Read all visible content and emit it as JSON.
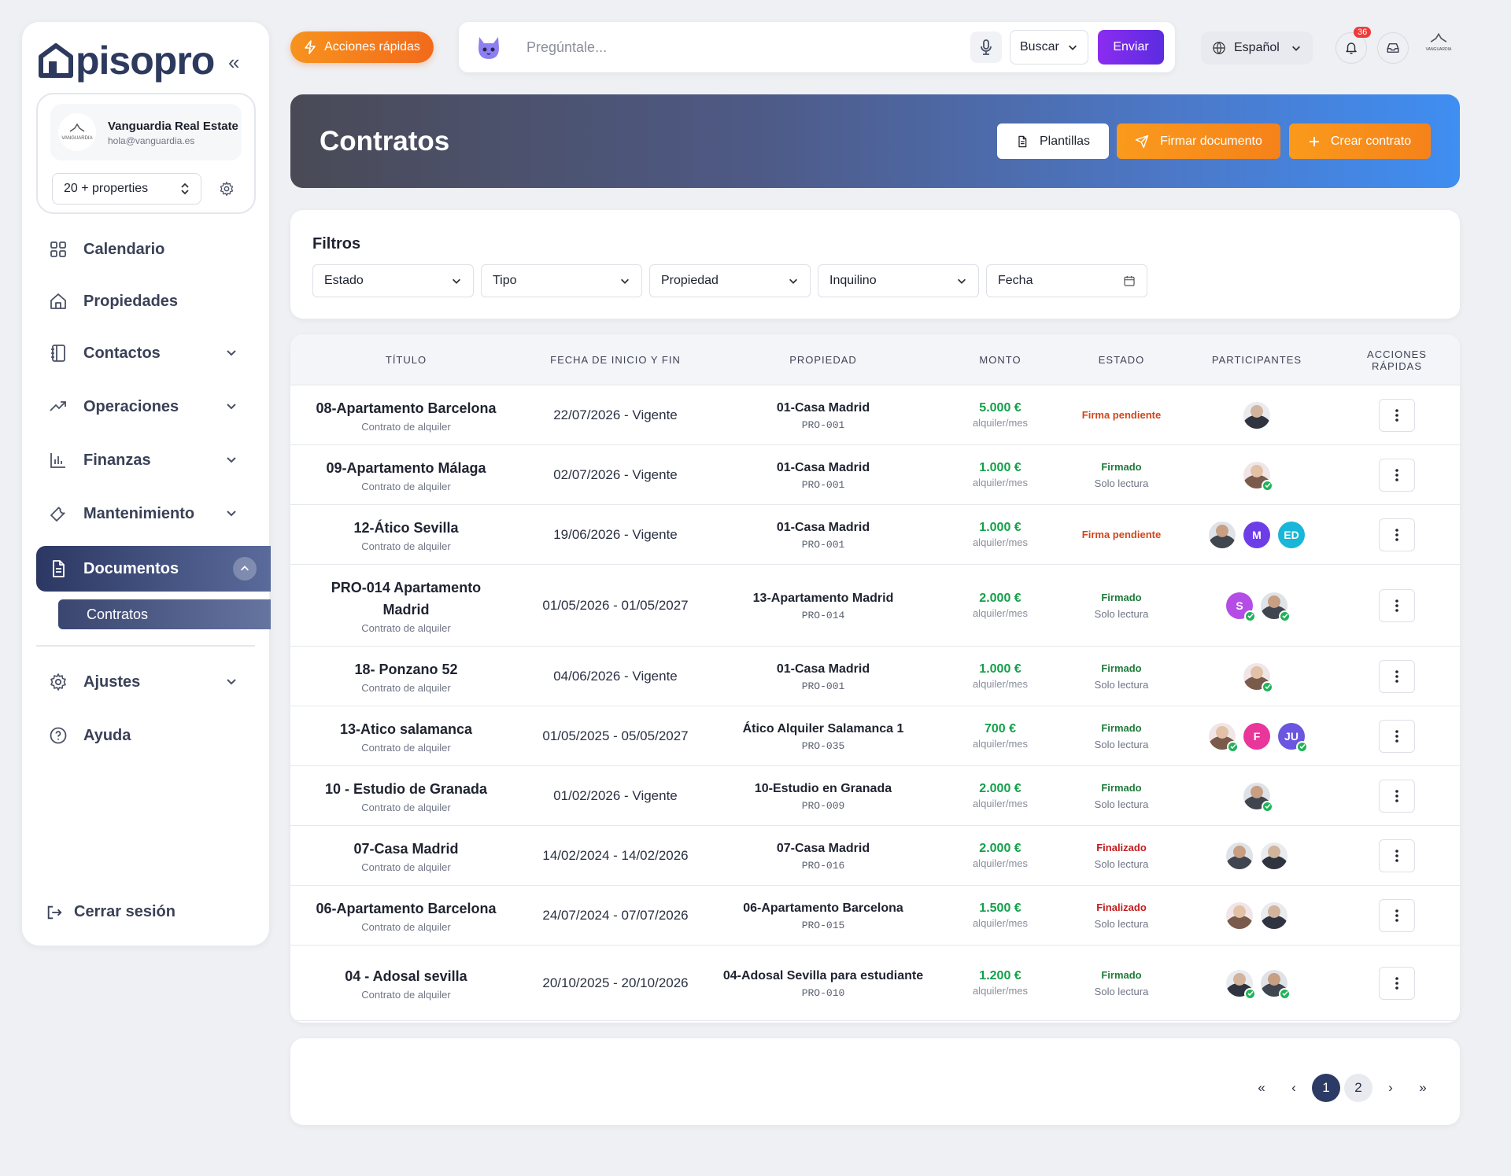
{
  "app": {
    "logo_text": "pisopro"
  },
  "account": {
    "name": "Vanguardia Real Estate",
    "email": "hola@vanguardia.es",
    "logo_text": "VANGUARDIA",
    "properties_select": "20 + properties"
  },
  "nav": {
    "calendario": "Calendario",
    "propiedades": "Propiedades",
    "contactos": "Contactos",
    "operaciones": "Operaciones",
    "finanzas": "Finanzas",
    "mantenimiento": "Mantenimiento",
    "documentos": "Documentos",
    "contratos": "Contratos",
    "ajustes": "Ajustes",
    "ayuda": "Ayuda",
    "logout": "Cerrar sesión"
  },
  "topbar": {
    "quick_actions": "Acciones rápidas",
    "search_placeholder": "Pregúntale...",
    "search_mode": "Buscar",
    "send": "Enviar",
    "language": "Español",
    "notification_count": "36",
    "user_logo_text": "VANGUARDIA"
  },
  "header": {
    "title": "Contratos",
    "plantillas": "Plantillas",
    "firmar": "Firmar documento",
    "crear": "Crear contrato"
  },
  "filters": {
    "title": "Filtros",
    "estado": "Estado",
    "tipo": "Tipo",
    "propiedad": "Propiedad",
    "inquilino": "Inquilino",
    "fecha": "Fecha"
  },
  "table": {
    "headers": {
      "titulo": "TÍTULO",
      "fechas": "FECHA DE INICIO Y FIN",
      "propiedad": "PROPIEDAD",
      "monto": "MONTO",
      "estado": "ESTADO",
      "participantes": "PARTICIPANTES",
      "acciones_1": "ACCIONES",
      "acciones_2": "RÁPIDAS"
    },
    "per_month": "alquiler/mes",
    "rows": [
      {
        "title": "08-Apartamento Barcelona",
        "type": "Contrato de alquiler",
        "dates": "22/07/2026 - Vigente",
        "property": "01-Casa Madrid",
        "code": "PRO-001",
        "amount": "5.000 €",
        "status": "Firma pendiente",
        "status_sub": ""
      },
      {
        "title": "09-Apartamento Málaga",
        "type": "Contrato de alquiler",
        "dates": "02/07/2026 - Vigente",
        "property": "01-Casa Madrid",
        "code": "PRO-001",
        "amount": "1.000 €",
        "status": "Firmado",
        "status_sub": "Solo lectura"
      },
      {
        "title": "12-Ático Sevilla",
        "type": "Contrato de alquiler",
        "dates": "19/06/2026 - Vigente",
        "property": "01-Casa Madrid",
        "code": "PRO-001",
        "amount": "1.000 €",
        "status": "Firma pendiente",
        "status_sub": ""
      },
      {
        "title": "PRO-014 Apartamento Madrid",
        "type": "Contrato de alquiler",
        "dates": "01/05/2026 - 01/05/2027",
        "property": "13-Apartamento Madrid",
        "code": "PRO-014",
        "amount": "2.000 €",
        "status": "Firmado",
        "status_sub": "Solo lectura"
      },
      {
        "title": "18- Ponzano 52",
        "type": "Contrato de alquiler",
        "dates": "04/06/2026 - Vigente",
        "property": "01-Casa Madrid",
        "code": "PRO-001",
        "amount": "1.000 €",
        "status": "Firmado",
        "status_sub": "Solo lectura"
      },
      {
        "title": "13-Atico salamanca",
        "type": "Contrato de alquiler",
        "dates": "01/05/2025 - 05/05/2027",
        "property": "Ático Alquiler Salamanca 1",
        "code": "PRO-035",
        "amount": "700 €",
        "status": "Firmado",
        "status_sub": "Solo lectura"
      },
      {
        "title": "10 - Estudio de Granada",
        "type": "Contrato de alquiler",
        "dates": "01/02/2026 - Vigente",
        "property": "10-Estudio en Granada",
        "code": "PRO-009",
        "amount": "2.000 €",
        "status": "Firmado",
        "status_sub": "Solo lectura"
      },
      {
        "title": "07-Casa Madrid",
        "type": "Contrato de alquiler",
        "dates": "14/02/2024 - 14/02/2026",
        "property": "07-Casa Madrid",
        "code": "PRO-016",
        "amount": "2.000 €",
        "status": "Finalizado",
        "status_sub": "Solo lectura"
      },
      {
        "title": "06-Apartamento Barcelona",
        "type": "Contrato de alquiler",
        "dates": "24/07/2024 - 07/07/2026",
        "property": "06-Apartamento Barcelona",
        "code": "PRO-015",
        "amount": "1.500 €",
        "status": "Finalizado",
        "status_sub": "Solo lectura"
      },
      {
        "title": "04 - Adosal sevilla",
        "type": "Contrato de alquiler",
        "dates": "20/10/2025 - 20/10/2026",
        "property": "04-Adosal Sevilla para estudiante",
        "code": "PRO-010",
        "amount": "1.200 €",
        "status": "Firmado",
        "status_sub": "Solo lectura"
      }
    ],
    "participants": {
      "r3_m": "M",
      "r3_ed": "ED",
      "r4_s": "S",
      "r6_f": "F",
      "r6_ju": "JU"
    }
  },
  "pagination": {
    "first": "«",
    "prev": "‹",
    "page1": "1",
    "page2": "2",
    "next": "›",
    "last": "»"
  },
  "colors": {
    "accent_orange": "#f5821a",
    "brand_navy": "#2c3a66",
    "success_green": "#14a04a",
    "purple": "#6d2ce8"
  }
}
